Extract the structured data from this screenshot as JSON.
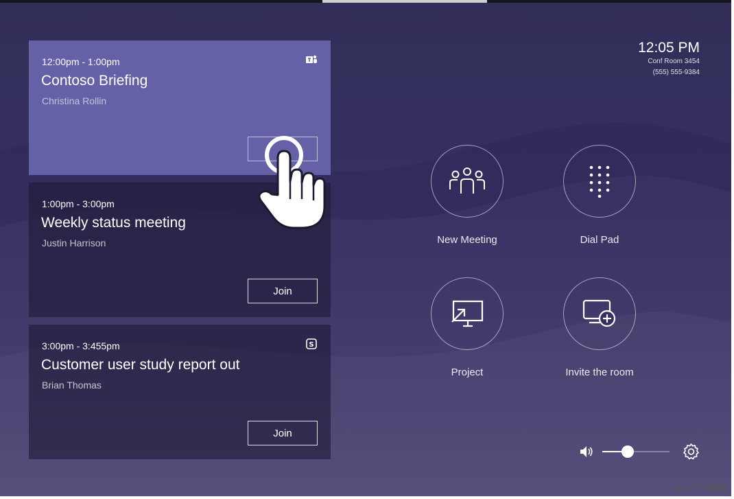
{
  "meetings": [
    {
      "time": "12:00pm - 1:00pm",
      "title": "Contoso Briefing",
      "organizer": "Christina Rollin",
      "join_label": "",
      "icon": "teams-icon"
    },
    {
      "time": "1:00pm - 3:00pm",
      "title": "Weekly status meeting",
      "organizer": "Justin Harrison",
      "join_label": "Join",
      "icon": "teams-icon"
    },
    {
      "time": "3:00pm - 3:455pm",
      "title": "Customer user study report out",
      "organizer": "Brian Thomas",
      "join_label": "Join",
      "icon": "skype-icon"
    }
  ],
  "clock": {
    "time": "12:05 PM",
    "room": "Conf Room 3454",
    "phone": "(555) 555-9384"
  },
  "actions": [
    {
      "label": "New Meeting",
      "icon": "people-icon"
    },
    {
      "label": "Dial Pad",
      "icon": "dial-pad-icon"
    },
    {
      "label": "Project",
      "icon": "project-screen-icon"
    },
    {
      "label": "Invite the room",
      "icon": "invite-room-icon"
    }
  ],
  "volume": {
    "level": 0.38
  },
  "watermark": "@51CTO博客",
  "colors": {
    "background": "#2d2955",
    "selected_card": "#6461a6",
    "card": "#25223f"
  }
}
